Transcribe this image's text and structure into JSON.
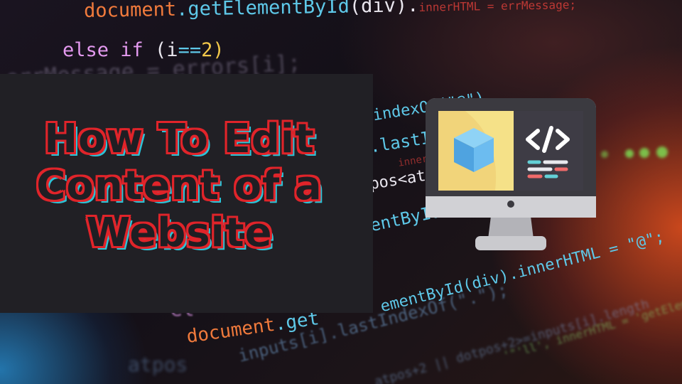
{
  "code_lines": [
    {
      "text": "document.getElementById(div).innerHTML = errMessage;",
      "parts": [
        "document",
        ".getElementById",
        "(div).",
        "innerHTML = errMessage;"
      ]
    },
    {
      "text": "else if (i==2)",
      "parts": [
        "else if",
        " (i",
        "==",
        "2)"
      ]
    },
    {
      "text": "errMessage = errors[i];"
    },
    {
      "text": "indexOf(\"@\")"
    },
    {
      "text": ".lastI"
    },
    {
      "text": "innerHTML"
    },
    {
      "text": "pos<atr"
    },
    {
      "text": "entById(d"
    },
    {
      "text": "ementById(div).innerHTML = \"@\";"
    },
    {
      "text": "el"
    },
    {
      "text": "document.get",
      "parts": [
        "document",
        ".get"
      ]
    },
    {
      "text": "inputs[i].lastIndexOf(\".\");"
    },
    {
      "text": "atpos+2 || dotpos+2>=inputs[i].length"
    },
    {
      "text": "atpos"
    },
    {
      "text": "'\"'ll', innerHTML = 'getElementById('message')"
    }
  ],
  "title": {
    "lines": [
      "How To Edit",
      "Content of a",
      "Website"
    ]
  },
  "monitor_icon": {
    "code_symbol": "</>",
    "colors": {
      "frame": "#a9a9ad",
      "bezel": "#3b3a40",
      "left_panel": "#f1d57a",
      "right_panel": "#3d3b44",
      "cube": "#5fb8ee",
      "stand": "#b6b6ba",
      "base": "#c9c9cd"
    }
  }
}
